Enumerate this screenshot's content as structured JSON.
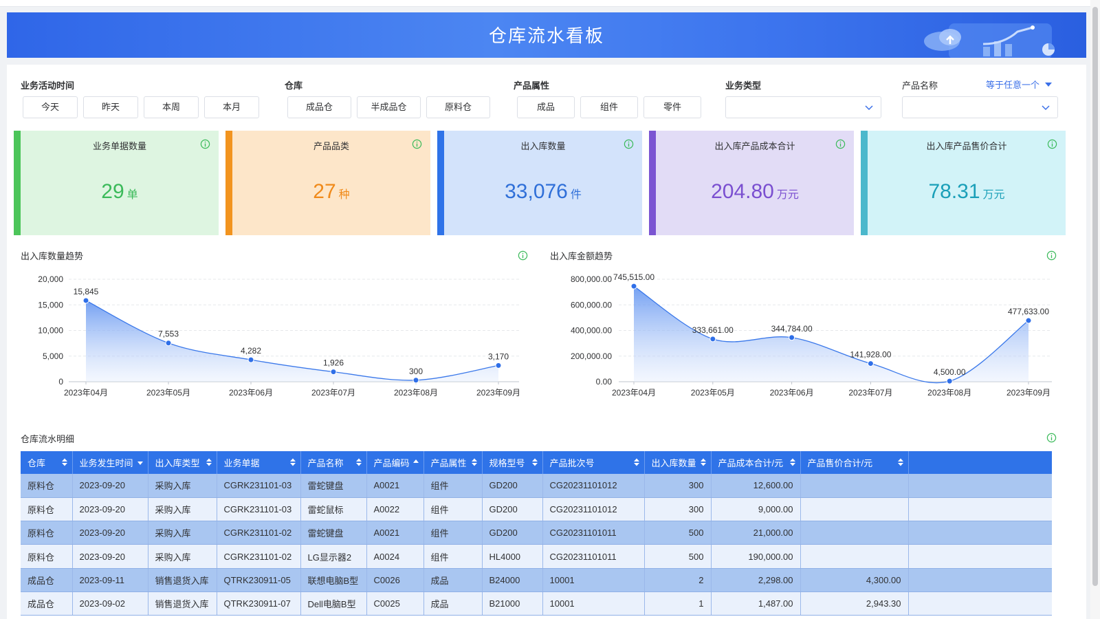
{
  "header": {
    "title": "仓库流水看板"
  },
  "filters": {
    "time": {
      "label": "业务活动时间",
      "options": [
        "今天",
        "昨天",
        "本周",
        "本月"
      ]
    },
    "warehouse": {
      "label": "仓库",
      "options": [
        "成品仓",
        "半成品仓",
        "原料仓"
      ]
    },
    "attribute": {
      "label": "产品属性",
      "options": [
        "成品",
        "组件",
        "零件"
      ]
    },
    "biz_type": {
      "label": "业务类型",
      "value": ""
    },
    "product_name": {
      "label": "产品名称",
      "operator": "等于任意一个",
      "value": ""
    }
  },
  "cards": [
    {
      "title": "业务单据数量",
      "value": "29",
      "unit": "单",
      "color": "#3bba5a",
      "bg": "#def5e1",
      "bar": "#4cc55a"
    },
    {
      "title": "产品品类",
      "value": "27",
      "unit": "种",
      "color": "#f08a1a",
      "bg": "#fde6c9",
      "bar": "#f2941f"
    },
    {
      "title": "出入库数量",
      "value": "33,076",
      "unit": "件",
      "color": "#2f6fd8",
      "bg": "#d3e3fb",
      "bar": "#2f73e8"
    },
    {
      "title": "出入库产品成本合计",
      "value": "204.80",
      "unit": "万元",
      "color": "#7a4fd0",
      "bg": "#e2dcf6",
      "bar": "#7b55d2"
    },
    {
      "title": "出入库产品售价合计",
      "value": "78.31",
      "unit": "万元",
      "color": "#1a9fb8",
      "bg": "#d2f3f8",
      "bar": "#4bb8cc"
    }
  ],
  "charts": {
    "qty_title": "出入库数量趋势",
    "amt_title": "出入库金额趋势"
  },
  "chart_data": [
    {
      "type": "area",
      "title": "出入库数量趋势",
      "categories": [
        "2023年04月",
        "2023年05月",
        "2023年06月",
        "2023年07月",
        "2023年08月",
        "2023年09月"
      ],
      "values": [
        15845,
        7553,
        4282,
        1926,
        300,
        3170
      ],
      "value_labels": [
        "15,845",
        "7,553",
        "4,282",
        "1,926",
        "300",
        "3,170"
      ],
      "yticks": [
        "0",
        "5,000",
        "10,000",
        "15,000",
        "20,000"
      ],
      "ylim": [
        0,
        20000
      ],
      "grid": true
    },
    {
      "type": "area",
      "title": "出入库金额趋势",
      "categories": [
        "2023年04月",
        "2023年05月",
        "2023年06月",
        "2023年07月",
        "2023年08月",
        "2023年09月"
      ],
      "values": [
        745515,
        333661,
        344784,
        141928,
        4500,
        477633
      ],
      "value_labels": [
        "745,515.00",
        "333,661.00",
        "344,784.00",
        "141,928.00",
        "4,500.00",
        "477,633.00"
      ],
      "yticks": [
        "0.00",
        "200,000.00",
        "400,000.00",
        "600,000.00",
        "800,000.00"
      ],
      "ylim": [
        0,
        800000
      ],
      "grid": true
    }
  ],
  "table": {
    "title": "仓库流水明细",
    "columns": [
      "仓库",
      "业务发生时间",
      "出入库类型",
      "业务单据",
      "产品名称",
      "产品编码",
      "产品属性",
      "规格型号",
      "产品批次号",
      "出入库数量",
      "产品成本合计/元",
      "产品售价合计/元"
    ],
    "rows": [
      [
        "原料仓",
        "2023-09-20",
        "采购入库",
        "CGRK231101-03",
        "雷蛇键盘",
        "A0021",
        "组件",
        "GD200",
        "CG20231101012",
        "300",
        "12,600.00",
        ""
      ],
      [
        "原料仓",
        "2023-09-20",
        "采购入库",
        "CGRK231101-03",
        "雷蛇鼠标",
        "A0022",
        "组件",
        "GD200",
        "CG20231101012",
        "300",
        "9,000.00",
        ""
      ],
      [
        "原料仓",
        "2023-09-20",
        "采购入库",
        "CGRK231101-02",
        "雷蛇键盘",
        "A0021",
        "组件",
        "GD200",
        "CG20231101011",
        "500",
        "21,000.00",
        ""
      ],
      [
        "原料仓",
        "2023-09-20",
        "采购入库",
        "CGRK231101-02",
        "LG显示器2",
        "A0024",
        "组件",
        "HL4000",
        "CG20231101011",
        "500",
        "190,000.00",
        ""
      ],
      [
        "成品仓",
        "2023-09-11",
        "销售退货入库",
        "QTRK230911-05",
        "联想电脑B型",
        "C0026",
        "成品",
        "B24000",
        "10001",
        "2",
        "2,298.00",
        "4,300.00"
      ],
      [
        "成品仓",
        "2023-09-02",
        "销售退货入库",
        "QTRK230911-07",
        "Dell电脑B型",
        "C0025",
        "成品",
        "B21000",
        "10001",
        "1",
        "1,487.00",
        "2,943.30"
      ]
    ]
  },
  "icons": {
    "info": "info-circle-icon",
    "chevron": "chevron-down-icon",
    "sort": "sort-icon"
  }
}
